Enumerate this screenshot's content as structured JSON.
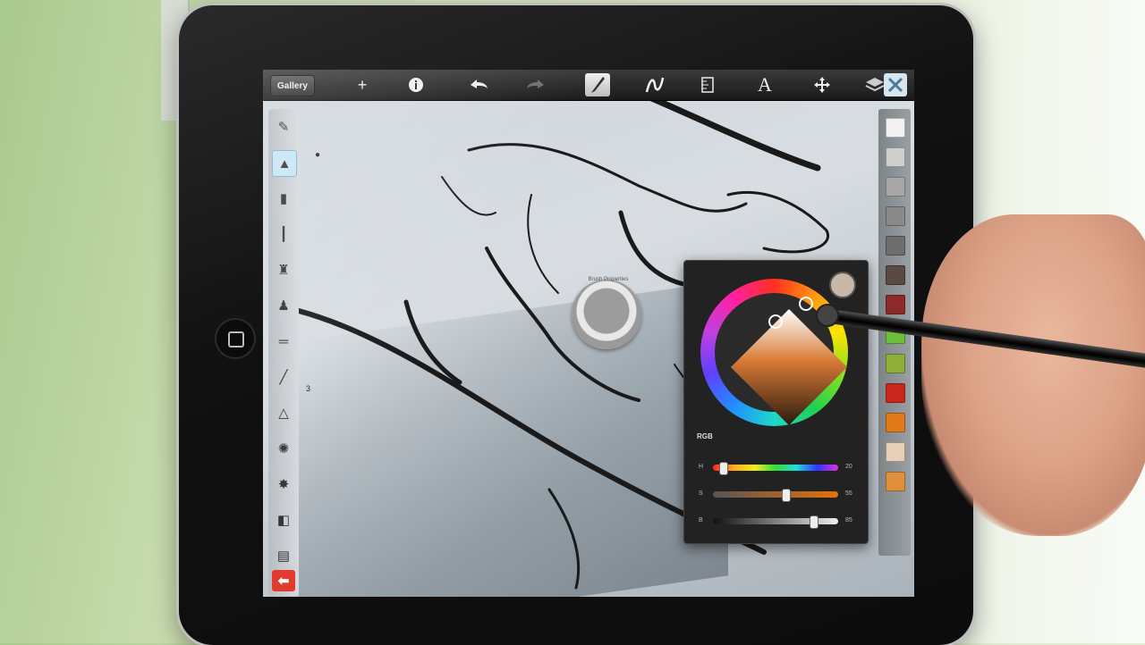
{
  "toolbar": {
    "gallery_label": "Gallery",
    "icons": [
      "add-icon",
      "info-icon",
      "undo-arrow-icon",
      "redo-arrow-icon",
      "brush-icon",
      "curve-icon",
      "ruler-icon",
      "text-icon",
      "move-icon",
      "layers-icon"
    ],
    "text_tool_glyph": "A"
  },
  "brush_puck": {
    "label": "Brush Properties"
  },
  "left_toolbar": {
    "tools": [
      "pencil",
      "marker",
      "airbrush",
      "ballpoint",
      "chisel",
      "smudge",
      "brush",
      "eraser",
      "splatter",
      "blob",
      "fill",
      "blend"
    ],
    "brush_size_number": "3"
  },
  "swatches": {
    "colors": [
      "#f2f2f2",
      "#cfcfcf",
      "#a8a8a8",
      "#8a8a8a",
      "#6e6e6e",
      "#5a4a44",
      "#8c2a2a",
      "#6cbf3a",
      "#8fae3a",
      "#c8281e",
      "#e07a1a",
      "#e8d0b8",
      "#e0903a"
    ]
  },
  "color_panel": {
    "mode_label": "RGB",
    "current_color": "#c9b8a8",
    "sliders": [
      {
        "label": "H",
        "value": "20",
        "fraction": 0.05
      },
      {
        "label": "S",
        "value": "55",
        "fraction": 0.58
      },
      {
        "label": "B",
        "value": "85",
        "fraction": 0.82
      }
    ]
  }
}
